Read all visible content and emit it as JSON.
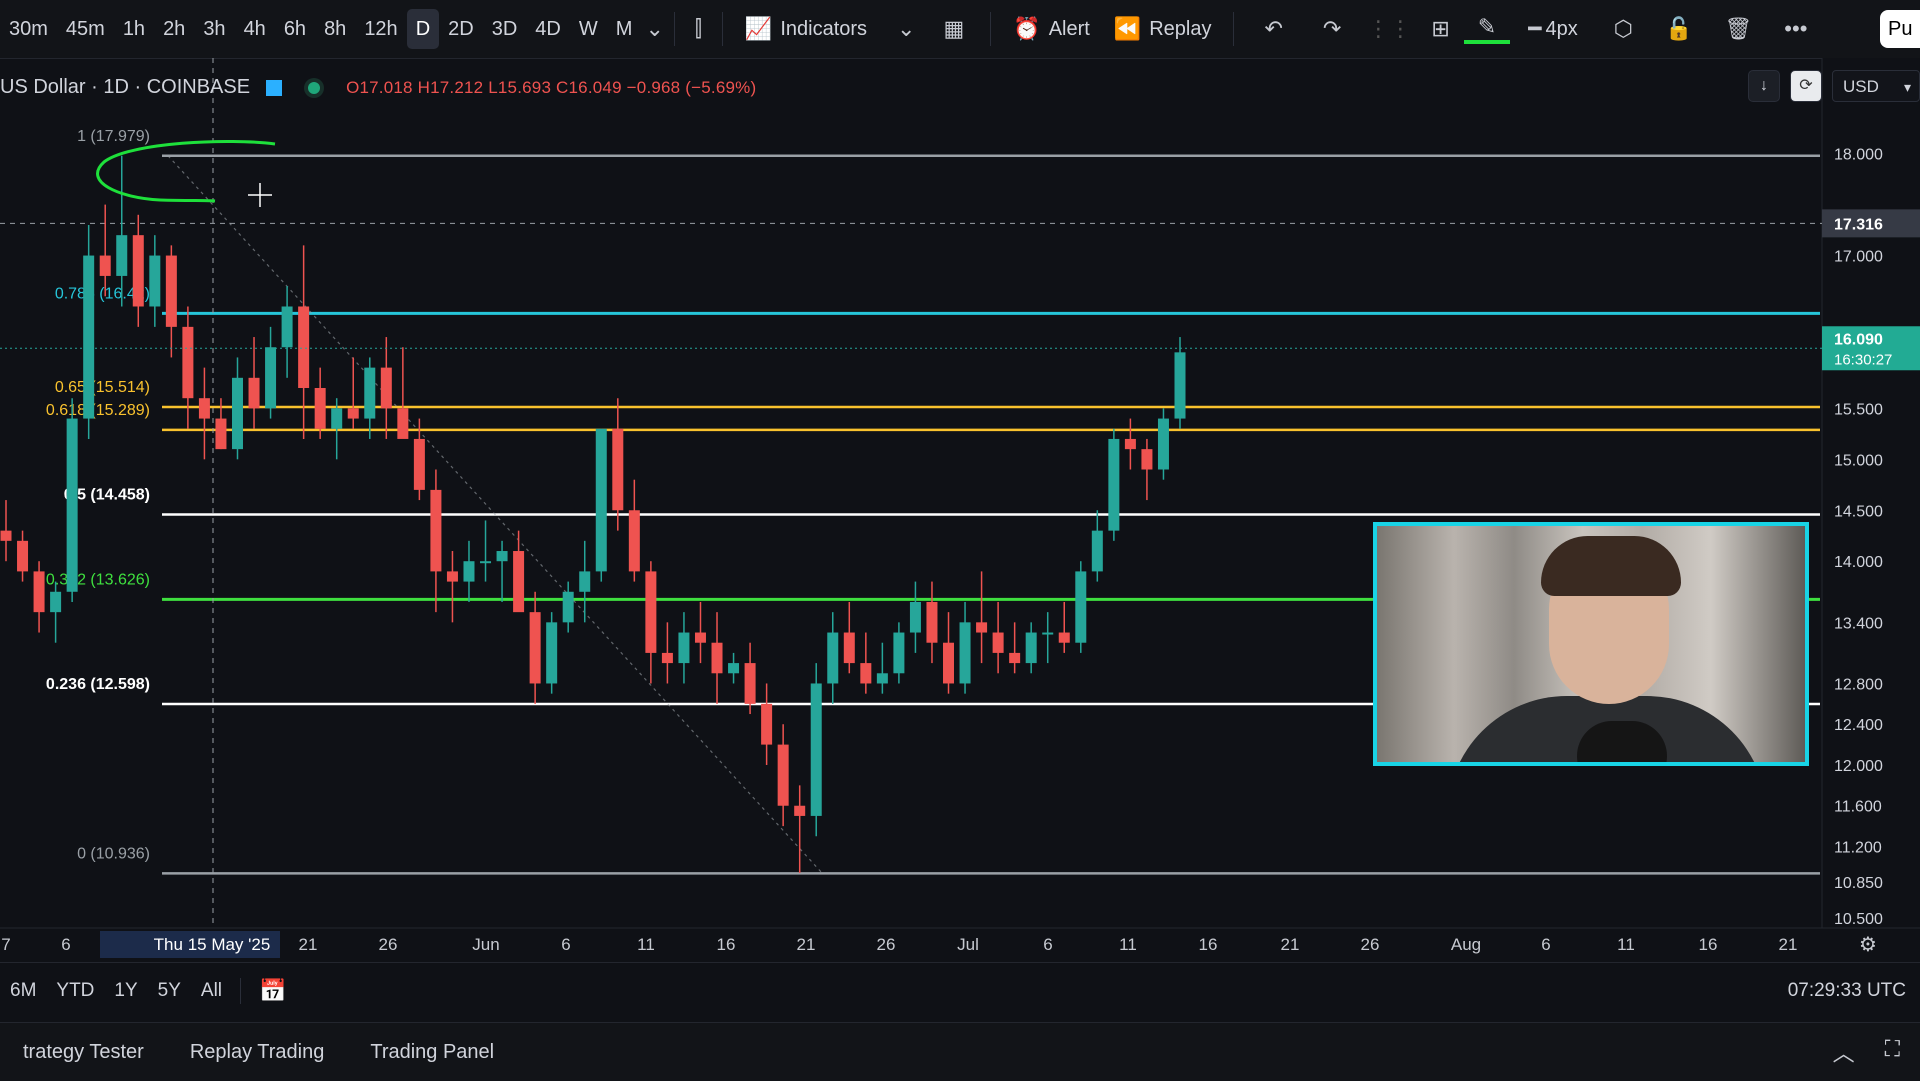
{
  "toolbar": {
    "timeframes": [
      "30m",
      "45m",
      "1h",
      "2h",
      "3h",
      "4h",
      "6h",
      "8h",
      "12h",
      "D",
      "2D",
      "3D",
      "4D",
      "W",
      "M"
    ],
    "active_timeframe": "D",
    "indicators_label": "Indicators",
    "alert_label": "Alert",
    "replay_label": "Replay",
    "stroke_width": "4px",
    "publish_label": "Pu"
  },
  "legend": {
    "symbol": "US Dollar · 1D · COINBASE",
    "open": "O17.018",
    "high": "H17.212",
    "low": "L15.693",
    "close": "C16.049",
    "change": "−0.968 (−5.69%)"
  },
  "currency": "USD",
  "chart_data": {
    "type": "candlestick",
    "price_axis_ticks": [
      "18.000",
      "17.000",
      "15.500",
      "15.000",
      "14.500",
      "14.000",
      "13.400",
      "12.800",
      "12.400",
      "12.000",
      "11.600",
      "11.200",
      "10.850",
      "10.500"
    ],
    "crosshair_price": "17.316",
    "last_price": "16.090",
    "countdown": "16:30:27",
    "date_axis_ticks": [
      "7",
      "6",
      "Thu 15 May '25",
      "21",
      "26",
      "Jun",
      "6",
      "11",
      "16",
      "21",
      "26",
      "Jul",
      "6",
      "11",
      "16",
      "21",
      "26",
      "Aug",
      "6",
      "11",
      "16",
      "21"
    ],
    "fib_levels": [
      {
        "label": "1 (17.979)",
        "value": 17.979,
        "color": "#9aa0a6"
      },
      {
        "label": "0.786 (16.4​2)",
        "value": 16.432,
        "color": "#26c6da"
      },
      {
        "label": "0.65 (15.514)",
        "value": 15.514,
        "color": "#f9c22e"
      },
      {
        "label": "0.618 (15.289)",
        "value": 15.289,
        "color": "#f9c22e"
      },
      {
        "label": "0.5 (14.458)",
        "value": 14.458,
        "color": "#ffffff"
      },
      {
        "label": "0.382 (13.626)",
        "value": 13.626,
        "color": "#3fe03f"
      },
      {
        "label": "0.236 (12.598)",
        "value": 12.598,
        "color": "#ffffff"
      },
      {
        "label": "0 (10.936)",
        "value": 10.936,
        "color": "#9aa0a6"
      }
    ],
    "candles": [
      [
        14.3,
        14.6,
        14.0,
        14.2
      ],
      [
        14.2,
        14.3,
        13.8,
        13.9
      ],
      [
        13.9,
        14.0,
        13.3,
        13.5
      ],
      [
        13.5,
        13.8,
        13.2,
        13.7
      ],
      [
        13.7,
        15.6,
        13.6,
        15.4
      ],
      [
        15.4,
        17.3,
        15.2,
        17.0
      ],
      [
        17.0,
        17.5,
        16.6,
        16.8
      ],
      [
        16.8,
        17.98,
        16.5,
        17.2
      ],
      [
        17.2,
        17.4,
        16.3,
        16.5
      ],
      [
        16.5,
        17.2,
        16.3,
        17.0
      ],
      [
        17.0,
        17.1,
        16.0,
        16.3
      ],
      [
        16.3,
        16.5,
        15.3,
        15.6
      ],
      [
        15.6,
        15.9,
        15.0,
        15.4
      ],
      [
        15.4,
        15.6,
        15.1,
        15.1
      ],
      [
        15.1,
        16.0,
        15.0,
        15.8
      ],
      [
        15.8,
        16.2,
        15.3,
        15.5
      ],
      [
        15.5,
        16.3,
        15.4,
        16.1
      ],
      [
        16.1,
        16.7,
        15.8,
        16.5
      ],
      [
        16.5,
        17.1,
        15.2,
        15.7
      ],
      [
        15.7,
        15.9,
        15.2,
        15.3
      ],
      [
        15.3,
        15.6,
        15.0,
        15.5
      ],
      [
        15.5,
        16.0,
        15.3,
        15.4
      ],
      [
        15.4,
        16.0,
        15.2,
        15.9
      ],
      [
        15.9,
        16.2,
        15.2,
        15.5
      ],
      [
        15.5,
        16.1,
        15.3,
        15.2
      ],
      [
        15.2,
        15.4,
        14.6,
        14.7
      ],
      [
        14.7,
        14.9,
        13.5,
        13.9
      ],
      [
        13.9,
        14.1,
        13.4,
        13.8
      ],
      [
        13.8,
        14.2,
        13.6,
        14.0
      ],
      [
        14.0,
        14.4,
        13.8,
        14.0
      ],
      [
        14.0,
        14.2,
        13.6,
        14.1
      ],
      [
        14.1,
        14.3,
        13.6,
        13.5
      ],
      [
        13.5,
        13.7,
        12.6,
        12.8
      ],
      [
        12.8,
        13.5,
        12.7,
        13.4
      ],
      [
        13.4,
        13.8,
        13.3,
        13.7
      ],
      [
        13.7,
        14.2,
        13.4,
        13.9
      ],
      [
        13.9,
        15.3,
        13.8,
        15.3
      ],
      [
        15.3,
        15.6,
        14.3,
        14.5
      ],
      [
        14.5,
        14.8,
        13.8,
        13.9
      ],
      [
        13.9,
        14.0,
        12.8,
        13.1
      ],
      [
        13.1,
        13.4,
        12.8,
        13.0
      ],
      [
        13.0,
        13.5,
        12.8,
        13.3
      ],
      [
        13.3,
        13.6,
        13.0,
        13.2
      ],
      [
        13.2,
        13.5,
        12.6,
        12.9
      ],
      [
        12.9,
        13.1,
        12.8,
        13.0
      ],
      [
        13.0,
        13.2,
        12.5,
        12.6
      ],
      [
        12.6,
        12.8,
        12.0,
        12.2
      ],
      [
        12.2,
        12.4,
        11.4,
        11.6
      ],
      [
        11.6,
        11.8,
        10.94,
        11.5
      ],
      [
        11.5,
        13.0,
        11.3,
        12.8
      ],
      [
        12.8,
        13.5,
        12.6,
        13.3
      ],
      [
        13.3,
        13.6,
        12.9,
        13.0
      ],
      [
        13.0,
        13.3,
        12.7,
        12.8
      ],
      [
        12.8,
        13.2,
        12.7,
        12.9
      ],
      [
        12.9,
        13.4,
        12.8,
        13.3
      ],
      [
        13.3,
        13.8,
        13.1,
        13.6
      ],
      [
        13.6,
        13.8,
        13.0,
        13.2
      ],
      [
        13.2,
        13.5,
        12.7,
        12.8
      ],
      [
        12.8,
        13.6,
        12.7,
        13.4
      ],
      [
        13.4,
        13.9,
        13.0,
        13.3
      ],
      [
        13.3,
        13.6,
        12.9,
        13.1
      ],
      [
        13.1,
        13.4,
        12.9,
        13.0
      ],
      [
        13.0,
        13.4,
        12.9,
        13.3
      ],
      [
        13.3,
        13.5,
        13.0,
        13.3
      ],
      [
        13.3,
        13.6,
        13.1,
        13.2
      ],
      [
        13.2,
        14.0,
        13.1,
        13.9
      ],
      [
        13.9,
        14.5,
        13.8,
        14.3
      ],
      [
        14.3,
        15.3,
        14.2,
        15.2
      ],
      [
        15.2,
        15.4,
        14.9,
        15.1
      ],
      [
        15.1,
        15.2,
        14.6,
        14.9
      ],
      [
        14.9,
        15.5,
        14.8,
        15.4
      ],
      [
        15.4,
        16.2,
        15.3,
        16.05
      ]
    ],
    "x_range": [
      0,
      124
    ],
    "y_range": [
      10.4,
      18.35
    ]
  },
  "bottom": {
    "ranges": [
      "6M",
      "YTD",
      "1Y",
      "5Y",
      "All"
    ],
    "clock": "07:29:33 UTC",
    "panel_tabs": [
      "trategy Tester",
      "Replay Trading",
      "Trading Panel"
    ]
  }
}
